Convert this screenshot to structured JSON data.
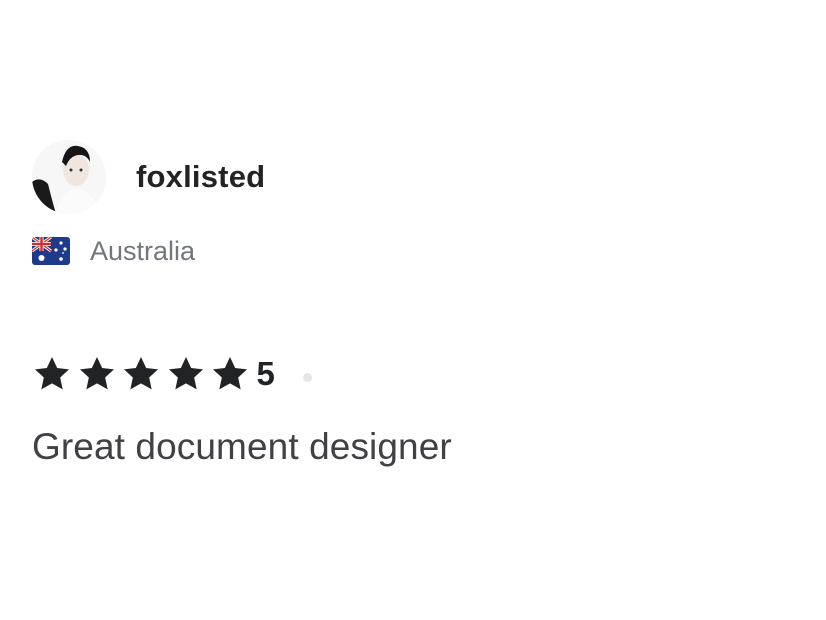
{
  "review": {
    "username": "foxlisted",
    "country": "Australia",
    "country_flag": "australia-flag-icon",
    "rating": {
      "value": "5",
      "stars_filled": 5,
      "stars_total": 5,
      "star_color": "#222325"
    },
    "text": "Great document designer"
  },
  "colors": {
    "username": "#222325",
    "country": "#74767e",
    "review_text": "#404145"
  }
}
